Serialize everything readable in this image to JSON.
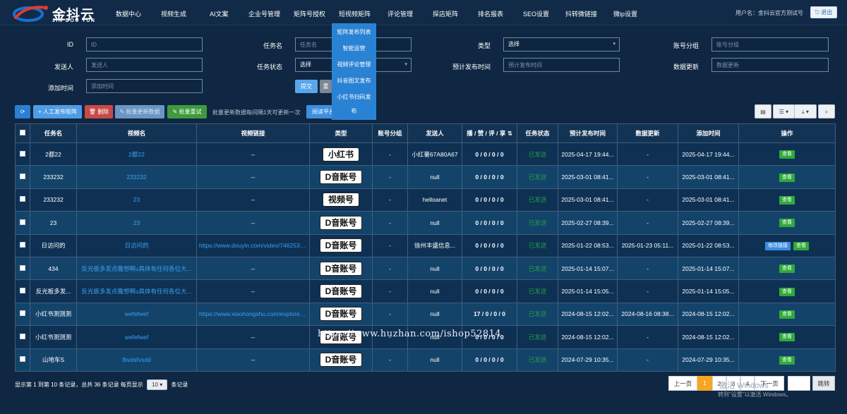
{
  "app": {
    "logo_title": "金抖云",
    "logo_sub": "JIN DOU YUN",
    "brand_color": "#1a6fd1"
  },
  "nav": {
    "items": [
      "数据中心",
      "视频生成",
      "AI文案",
      "企业号管理",
      "矩阵号授权",
      "短视频矩阵",
      "评论管理",
      "探店矩阵",
      "排名报表",
      "SEO设置",
      "抖转微链接",
      "微ip设置"
    ],
    "user": "用户名：金抖云官方测试号",
    "logout": "退出"
  },
  "dropdown": {
    "items": [
      "矩阵发布列表",
      "智能运营",
      "视频评论管理",
      "抖音图文发布",
      "小红书扫码发",
      "布"
    ]
  },
  "filters": {
    "id_label": "ID",
    "id_placeholder": "ID",
    "task_label": "任务名",
    "task_placeholder": "任务名",
    "type_label": "类型",
    "type_value": "选择",
    "group_label": "账号分组",
    "group_placeholder": "账号分组",
    "sender_label": "发送人",
    "sender_placeholder": "发送人",
    "status_label": "任务状态",
    "status_value": "选择",
    "schedule_label": "预计发布时间",
    "schedule_placeholder": "预计发布时间",
    "update_label": "数据更新",
    "update_placeholder": "数据更新",
    "added_label": "添加时间",
    "added_placeholder": "添加时间",
    "submit": "提交",
    "reset": "重"
  },
  "toolbar": {
    "add": "+ 人工发布矩阵",
    "delete": "删除",
    "batch_update": "批量更新数据",
    "batch_retry": "批量重试",
    "note": "批量更新数据每间隔1天可更新一次",
    "read_platform": "阅读平台"
  },
  "table": {
    "headers": [
      "任务名",
      "视频名",
      "视频链接",
      "类型",
      "账号分组",
      "发送人",
      "播 / 赞 / 评 / 享",
      "任务状态",
      "预计发布时间",
      "数据更新",
      "添加时间",
      "操作"
    ],
    "view_label": "查看",
    "edit_label": "修改链接",
    "rows": [
      {
        "task": "2都22",
        "video": "2都22",
        "link": "--",
        "type": "小红书",
        "group": "-",
        "sender": "小红薯67A80A67",
        "stats": "0 / 0 / 0 / 0",
        "status": "已发送",
        "schedule": "2025-04-17 19:44...",
        "update": "-",
        "added": "2025-04-17 19:44..."
      },
      {
        "task": "233232",
        "video": "233232",
        "link": "--",
        "type": "D音账号",
        "group": "-",
        "sender": "null",
        "stats": "0 / 0 / 0 / 0",
        "status": "已发送",
        "schedule": "2025-03-01 08:41...",
        "update": "-",
        "added": "2025-03-01 08:41..."
      },
      {
        "task": "233232",
        "video": "23",
        "link": "--",
        "type": "视频号",
        "group": "-",
        "sender": "helloanet",
        "stats": "0 / 0 / 0 / 0",
        "status": "已发送",
        "schedule": "2025-03-01 08:41...",
        "update": "-",
        "added": "2025-03-01 08:41..."
      },
      {
        "task": "23",
        "video": "23",
        "link": "--",
        "type": "D音账号",
        "group": "-",
        "sender": "null",
        "stats": "0 / 0 / 0 / 0",
        "status": "已发送",
        "schedule": "2025-02-27 08:39...",
        "update": "-",
        "added": "2025-02-27 08:39..."
      },
      {
        "task": "日访问的",
        "video": "日访问的",
        "link": "https://www.douyin.com/video/74625347...",
        "type": "D音账号",
        "group": "-",
        "sender": "徐州丰盛信息...",
        "stats": "0 / 0 / 0 / 0",
        "status": "已发送",
        "schedule": "2025-01-22 08:53...",
        "update": "2025-01-23 05:11...",
        "added": "2025-01-22 08:53...",
        "editable": true
      },
      {
        "task": "434",
        "video": "反光板多发点撒想啊u具体有任何各位大...",
        "link": "--",
        "type": "D音账号",
        "group": "-",
        "sender": "null",
        "stats": "0 / 0 / 0 / 0",
        "status": "已发送",
        "schedule": "2025-01-14 15:07...",
        "update": "-",
        "added": "2025-01-14 15:07..."
      },
      {
        "task": "反光板多发...",
        "video": "反光板多发点撒想啊u具体有任何各位大...",
        "link": "--",
        "type": "D音账号",
        "group": "-",
        "sender": "null",
        "stats": "0 / 0 / 0 / 0",
        "status": "已发送",
        "schedule": "2025-01-14 15:05...",
        "update": "-",
        "added": "2025-01-14 15:05..."
      },
      {
        "task": "小红书测测测",
        "video": "wefefwef",
        "link": "https://www.xiaohongshu.com/explore/6...",
        "type": "D音账号",
        "group": "-",
        "sender": "null",
        "stats": "17 / 0 / 0 / 0",
        "status": "已发送",
        "schedule": "2024-08-15 12:02...",
        "update": "2024-08-16 08:38...",
        "added": "2024-08-15 12:02..."
      },
      {
        "task": "小红书测测测",
        "video": "wefefwef",
        "link": "--",
        "type": "D音账号",
        "group": "-",
        "sender": "null",
        "stats": "0 / 0 / 0 / 0",
        "status": "已发送",
        "schedule": "2024-08-15 12:02...",
        "update": "-",
        "added": "2024-08-15 12:02..."
      },
      {
        "task": "山地车S",
        "video": "fbvdsfvsdd",
        "link": "--",
        "type": "D音账号",
        "group": "-",
        "sender": "null",
        "stats": "0 / 0 / 0 / 0",
        "status": "已发送",
        "schedule": "2024-07-29 10:35...",
        "update": "-",
        "added": "2024-07-29 10:35..."
      }
    ]
  },
  "footer": {
    "summary": "显示第 1 到第 10 条记录，总共 36 条记录 每页显示",
    "per_page": "10",
    "per_page_suffix": "条记录",
    "prev": "上一页",
    "pages": [
      "1",
      "2",
      "3",
      "4"
    ],
    "next": "下一页",
    "jump": "跳转"
  },
  "overlay": {
    "watermark": "https://www.huzhan.com/ishop52814",
    "activate": "激活 Windows",
    "activate_sub": "转到\"设置\"以激活 Windows。"
  }
}
